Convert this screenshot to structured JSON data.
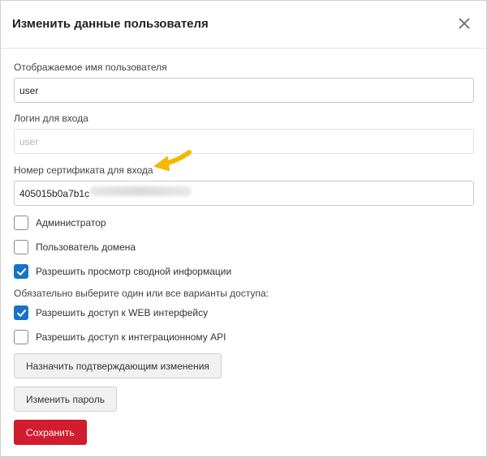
{
  "dialog": {
    "title": "Изменить данные пользователя"
  },
  "form": {
    "display_name": {
      "label": "Отображаемое имя пользователя",
      "value": "user"
    },
    "login": {
      "label": "Логин для входа",
      "placeholder": "user"
    },
    "certificate": {
      "label": "Номер сертификата для входа",
      "value": "405015b0a7b1c"
    },
    "checkboxes": [
      {
        "label": "Администратор",
        "checked": false
      },
      {
        "label": "Пользователь домена",
        "checked": false
      },
      {
        "label": "Разрешить просмотр сводной информации",
        "checked": true
      }
    ],
    "access_note": "Обязательно выберите один или все варианты доступа:",
    "access_checkboxes": [
      {
        "label": "Разрешить доступ к WEB интерфейсу",
        "checked": true
      },
      {
        "label": "Разрешить доступ к интеграционному API",
        "checked": false
      }
    ]
  },
  "buttons": {
    "assign_approvers": "Назначить подтверждающим изменения",
    "change_password": "Изменить пароль",
    "save": "Сохранить"
  },
  "colors": {
    "accent_blue": "#1673c7",
    "save_red": "#d21c2f",
    "annotation_arrow": "#f5b800"
  }
}
